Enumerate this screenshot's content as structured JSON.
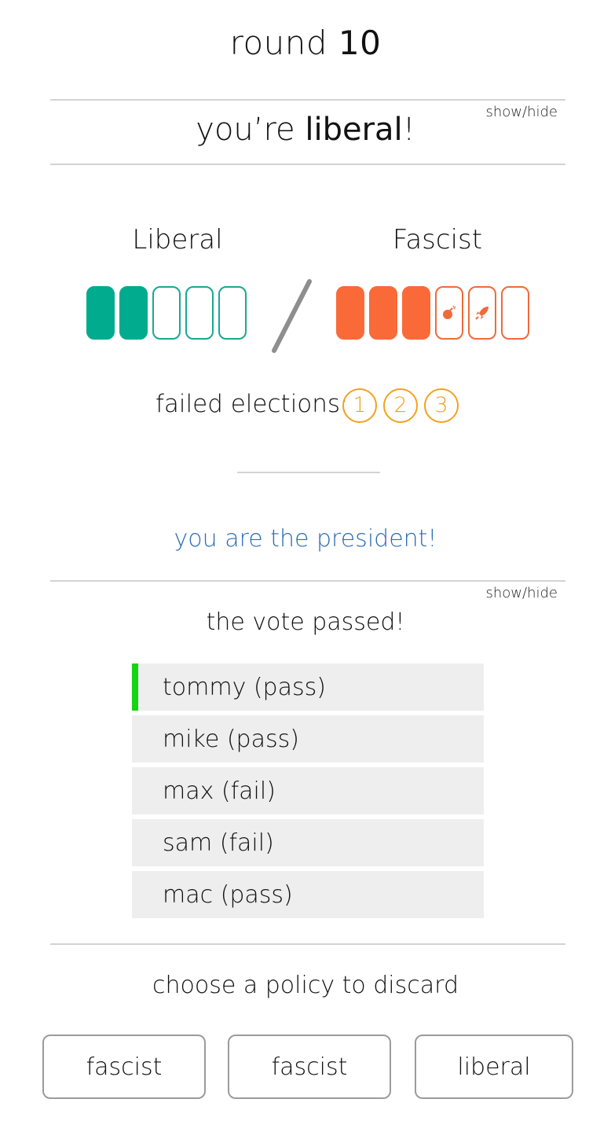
{
  "round": {
    "word": "round",
    "number": "10"
  },
  "role": {
    "prefix": "you’re ",
    "party": "liberal",
    "suffix": "!",
    "toggle": "show/hide"
  },
  "board": {
    "liberal": {
      "label": "Liberal",
      "enacted": 2,
      "slots": 5,
      "color": "#00ab8e"
    },
    "fascist": {
      "label": "Fascist",
      "enacted": 3,
      "slots": 6,
      "color": "#fa6a38",
      "powers": [
        "bomb-icon",
        "rocket-icon"
      ]
    }
  },
  "election_tracker": {
    "label": "failed elections:",
    "markers": [
      "1",
      "2",
      "3"
    ],
    "failed": 0,
    "color": "#f3a11f"
  },
  "status": {
    "president_message": "you are the president!",
    "color": "#2d6cb3"
  },
  "vote": {
    "toggle": "show/hide",
    "result": "the vote passed!",
    "players": [
      {
        "label": "tommy (pass)",
        "active": true
      },
      {
        "label": "mike (pass)",
        "active": false
      },
      {
        "label": "max (fail)",
        "active": false
      },
      {
        "label": "sam (fail)",
        "active": false
      },
      {
        "label": "mac (pass)",
        "active": false
      }
    ]
  },
  "discard": {
    "prompt": "choose a policy to discard",
    "policies": [
      "fascist",
      "fascist",
      "liberal"
    ]
  }
}
